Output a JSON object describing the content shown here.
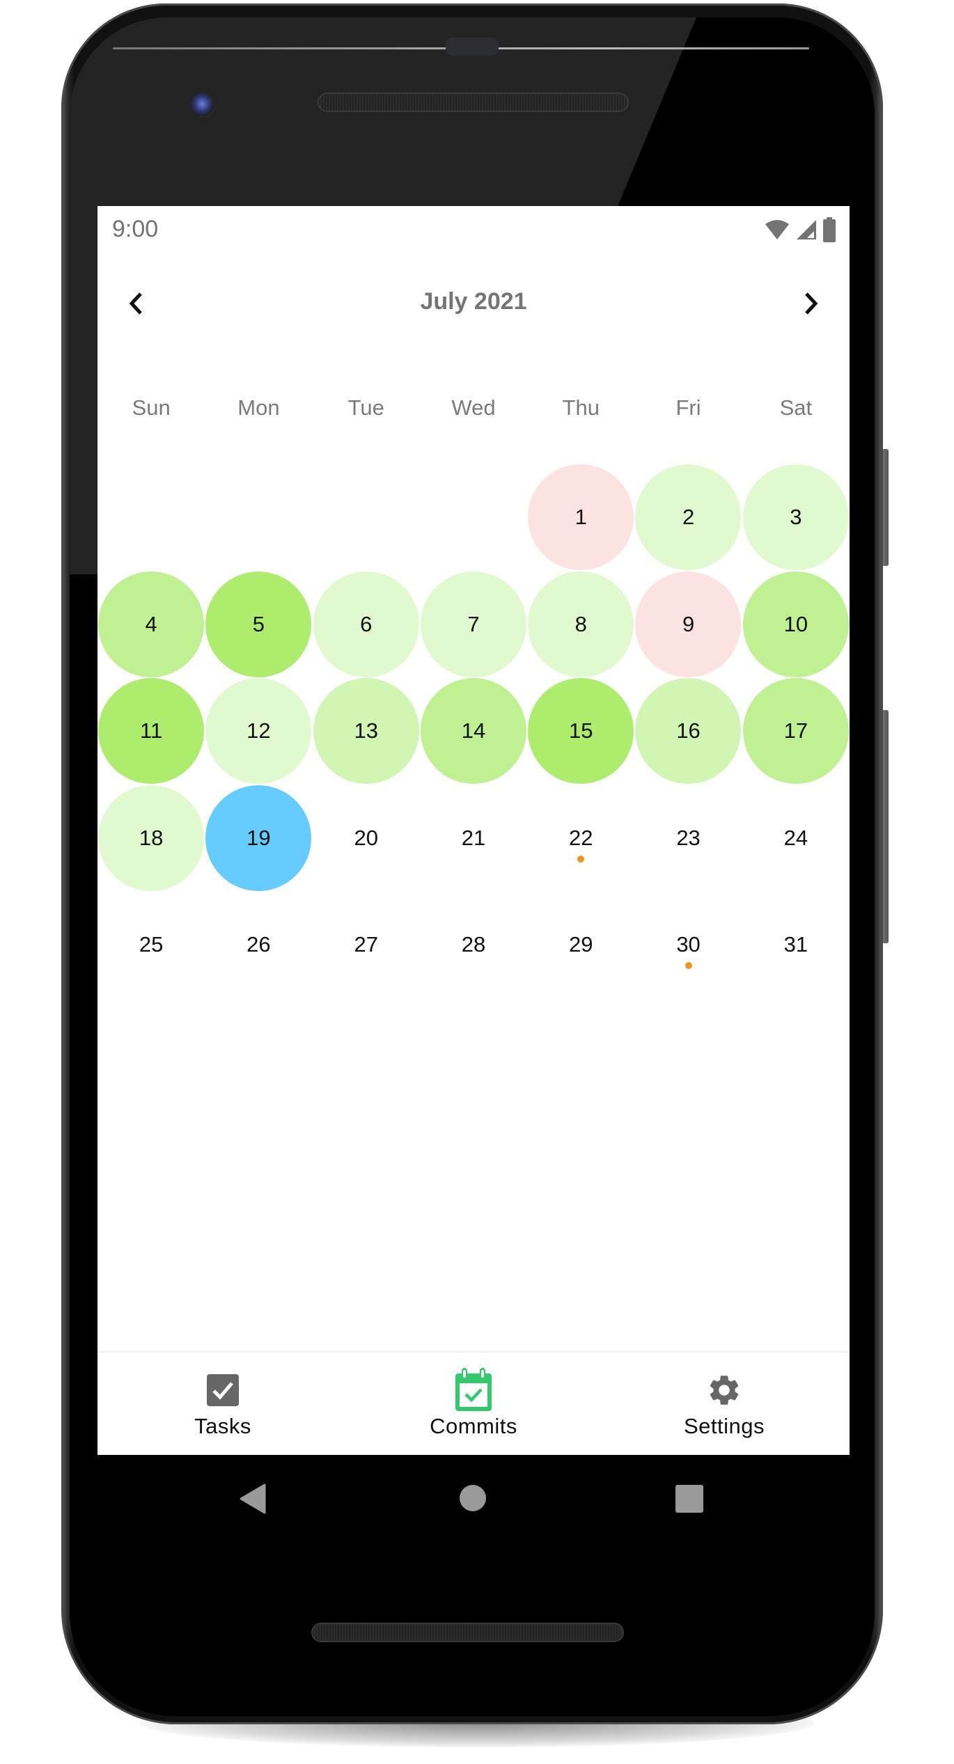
{
  "status_bar": {
    "time": "9:00",
    "icons": [
      "wifi-icon",
      "cellular-signal-icon",
      "battery-icon"
    ],
    "icon_color": "#737373"
  },
  "header": {
    "title": "July 2021",
    "prev_icon": "chevron-left-icon",
    "next_icon": "chevron-right-icon"
  },
  "calendar": {
    "month": "July",
    "year": 2021,
    "first_weekday_index": 4,
    "weekdays": [
      "Sun",
      "Mon",
      "Tue",
      "Wed",
      "Thu",
      "Fri",
      "Sat"
    ],
    "palette": {
      "missed": "#fde2e2",
      "level1": "#e1f9cf",
      "level2": "#d1f6b4",
      "level3": "#bff091",
      "level4": "#aeec6e",
      "today": "#66ccff",
      "event_dot": "#f39421"
    },
    "days": [
      {
        "day": "1",
        "status": "missed"
      },
      {
        "day": "2",
        "status": "level1"
      },
      {
        "day": "3",
        "status": "level1"
      },
      {
        "day": "4",
        "status": "level3"
      },
      {
        "day": "5",
        "status": "level4"
      },
      {
        "day": "6",
        "status": "level1"
      },
      {
        "day": "7",
        "status": "level1"
      },
      {
        "day": "8",
        "status": "level1"
      },
      {
        "day": "9",
        "status": "missed"
      },
      {
        "day": "10",
        "status": "level3"
      },
      {
        "day": "11",
        "status": "level4"
      },
      {
        "day": "12",
        "status": "level1"
      },
      {
        "day": "13",
        "status": "level2"
      },
      {
        "day": "14",
        "status": "level3"
      },
      {
        "day": "15",
        "status": "level4"
      },
      {
        "day": "16",
        "status": "level2"
      },
      {
        "day": "17",
        "status": "level3"
      },
      {
        "day": "18",
        "status": "level1"
      },
      {
        "day": "19",
        "status": "today"
      },
      {
        "day": "20",
        "status": "none"
      },
      {
        "day": "21",
        "status": "none"
      },
      {
        "day": "22",
        "status": "none",
        "event": true
      },
      {
        "day": "23",
        "status": "none"
      },
      {
        "day": "24",
        "status": "none"
      },
      {
        "day": "25",
        "status": "none"
      },
      {
        "day": "26",
        "status": "none"
      },
      {
        "day": "27",
        "status": "none"
      },
      {
        "day": "28",
        "status": "none"
      },
      {
        "day": "29",
        "status": "none"
      },
      {
        "day": "30",
        "status": "none",
        "event": true
      },
      {
        "day": "31",
        "status": "none"
      }
    ]
  },
  "tabbar": {
    "active_color": "#34c86f",
    "inactive_color": "#666666",
    "tabs": [
      {
        "label": "Tasks",
        "icon": "checkbox-icon",
        "active": false
      },
      {
        "label": "Commits",
        "icon": "calendar-check-icon",
        "active": true
      },
      {
        "label": "Settings",
        "icon": "gear-icon",
        "active": false
      }
    ]
  },
  "system_nav": {
    "buttons": [
      "back-icon",
      "home-icon",
      "recents-icon"
    ]
  }
}
